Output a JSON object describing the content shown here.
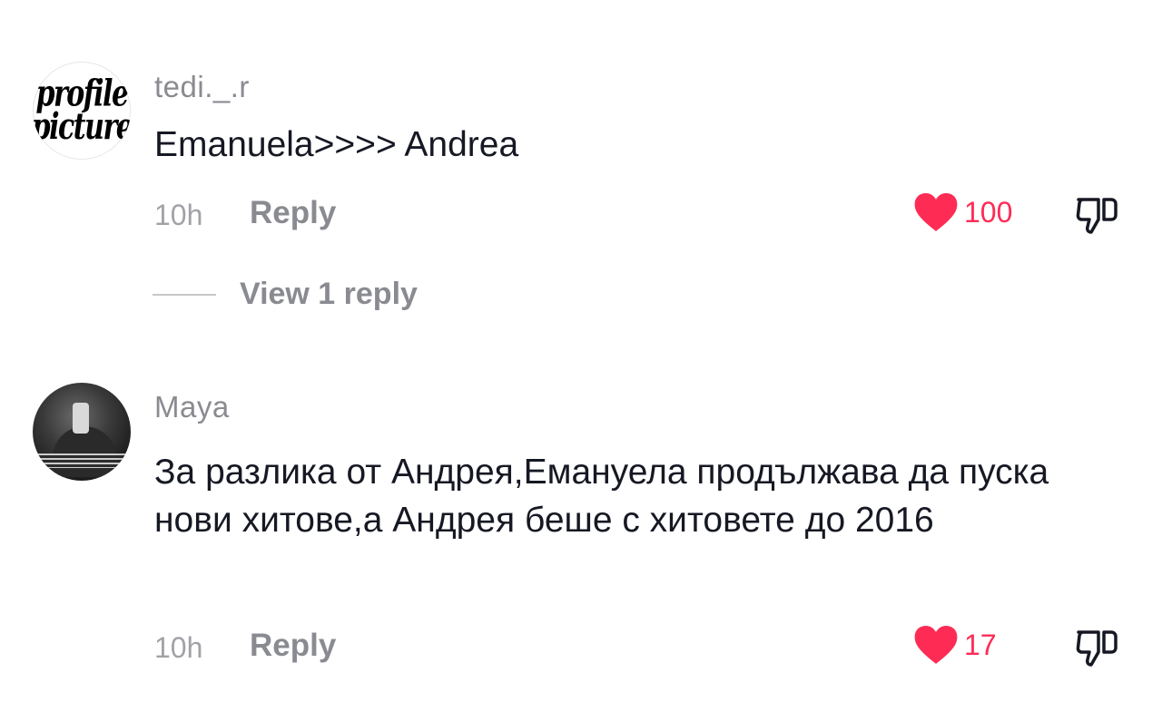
{
  "comments": [
    {
      "avatar_text": [
        "profile",
        "picture"
      ],
      "username": "tedi._.r",
      "text": "Emanuela>>>> Andrea",
      "time": "10h",
      "reply_label": "Reply",
      "likes": "100",
      "view_replies_label": "View 1 reply"
    },
    {
      "username": "Maya",
      "text": "За разлика от Андрея,Емануела продължава да пуска нови хитове,а Андрея беше с хитовете до 2016",
      "time": "10h",
      "reply_label": "Reply",
      "likes": "17"
    }
  ],
  "icons": {
    "like": "heart-icon",
    "dislike": "thumbs-down-icon"
  },
  "colors": {
    "like": "#fe2c55",
    "username": "#8a8b91",
    "text": "#161823",
    "meta": "#a1a2a7"
  }
}
